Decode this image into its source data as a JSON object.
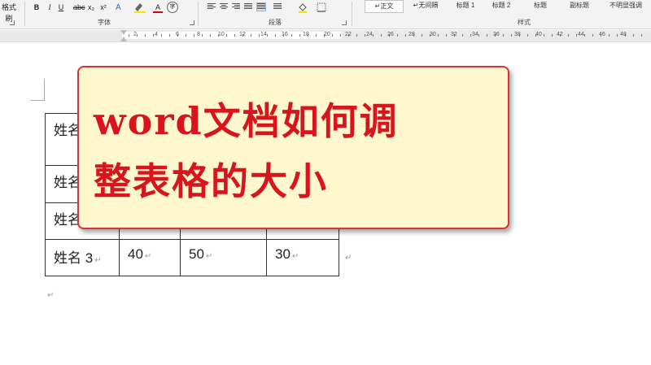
{
  "ribbon": {
    "clipboard_label": "格式刷",
    "font_group_label": "字体",
    "paragraph_group_label": "段落",
    "styles_group_label": "样式",
    "font_buttons": {
      "bold": "B",
      "italic": "I",
      "underline": "U",
      "strike": "abc",
      "subscript": "x₂",
      "superscript": "x²",
      "highlight_icon": "highlighter-icon",
      "font_color": "A",
      "encircle": "字"
    },
    "styles": [
      {
        "label": "↵正文",
        "selected": true
      },
      {
        "label": "↵无间隔",
        "selected": false
      },
      {
        "label": "标题 1",
        "selected": false
      },
      {
        "label": "标题 2",
        "selected": false
      },
      {
        "label": "标题",
        "selected": false
      },
      {
        "label": "副标题",
        "selected": false
      },
      {
        "label": "不明显强调",
        "selected": false
      }
    ],
    "colors": {
      "highlight": "#f7e600",
      "font_color": "#d0021b"
    }
  },
  "ruler": {
    "numbers": [
      "2",
      "4",
      "6",
      "8",
      "10",
      "12",
      "14",
      "16",
      "18",
      "20",
      "22",
      "24",
      "26",
      "28",
      "30",
      "32",
      "34",
      "36",
      "38",
      "40",
      "42",
      "44",
      "46",
      "48"
    ]
  },
  "table": {
    "rows": [
      [
        "姓名",
        "",
        "",
        ""
      ],
      [
        "姓名",
        "",
        "",
        ""
      ],
      [
        "姓名",
        "",
        "",
        ""
      ],
      [
        "姓名 3",
        "40",
        "50",
        "30"
      ]
    ]
  },
  "banner": {
    "line1": "word文档如何调",
    "line2": "整表格的大小"
  }
}
